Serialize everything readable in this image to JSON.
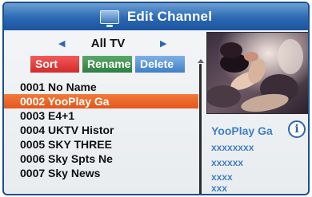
{
  "title": "Edit Channel",
  "group": {
    "name": "All TV",
    "left_arrow": "◀",
    "right_arrow": "▶"
  },
  "buttons": {
    "sort": "Sort",
    "rename": "Rename",
    "delete": "Delete"
  },
  "channels": [
    "0001 No Name",
    "0002 YooPlay Ga",
    "0003 E4+1",
    "0004 UKTV Histor",
    "0005 SKY THREE",
    "0006 Sky Spts Ne",
    "0007 Sky News"
  ],
  "selected_index": 1,
  "info": {
    "channel_name": "YooPlay Ga",
    "icon_glyph": "i",
    "line1": "xxxxxxxx",
    "line2": "xxxxxx",
    "line3": "xxxx",
    "line4": "xxx"
  },
  "colors": {
    "title_bar": "#2b67b3",
    "selected_row": "#e4561c",
    "sort_button": "#d42a2a",
    "rename_button": "#2f7f40",
    "delete_button": "#3f7fc8",
    "info_text": "#3f7fc8"
  }
}
